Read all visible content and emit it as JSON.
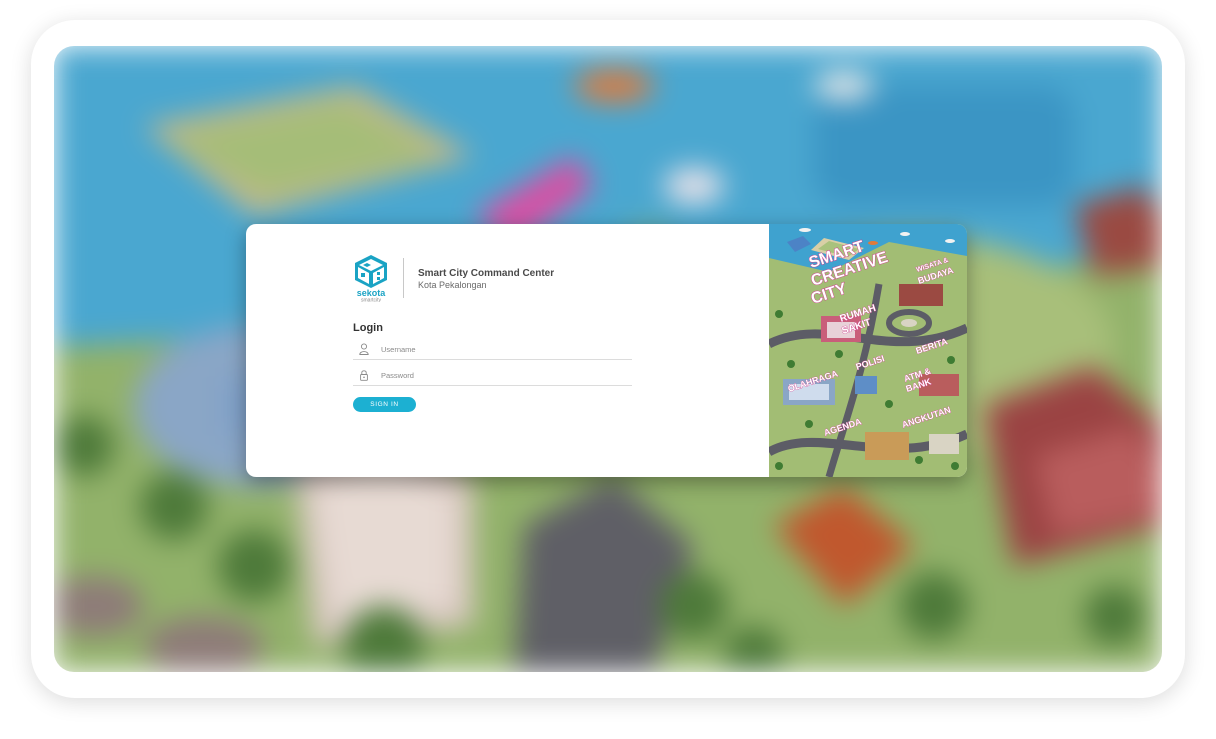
{
  "app": {
    "brand_name": "sekota",
    "brand_tagline": "smartcity",
    "title": "Smart City Command Center",
    "subtitle": "Kota Pekalongan"
  },
  "login": {
    "heading": "Login",
    "username_placeholder": "Username",
    "password_placeholder": "Password",
    "submit_label": "SIGN IN"
  },
  "illustration": {
    "headline_lines": [
      "SMART",
      "CREATIVE",
      "CITY"
    ],
    "labels": {
      "wisata_budaya": [
        "WISATA &",
        "BUDAYA"
      ],
      "rumah_sakit": [
        "RUMAH",
        "SAKIT"
      ],
      "berita": "BERITA",
      "polisi": "POLISI",
      "atm_bank": [
        "ATM &",
        "BANK"
      ],
      "olahraga": "OLAHRAGA",
      "agenda": "AGENDA",
      "angkutan": "ANGKUTAN"
    }
  },
  "colors": {
    "accent": "#1cb0d2",
    "logo": "#1aa3c4",
    "water": "#3fa2cf",
    "grass": "#9bb56a",
    "headline_pink": "#d13a8e"
  },
  "icons": {
    "username": "user-icon",
    "password": "lock-icon",
    "logo": "sekota-cube-logo"
  }
}
